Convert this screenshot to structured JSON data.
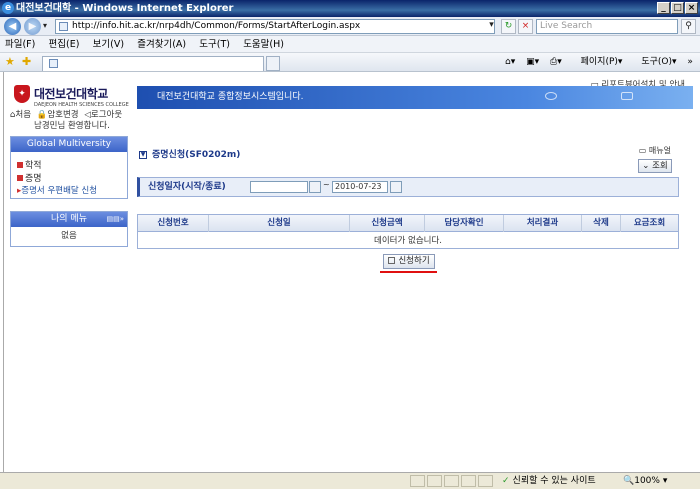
{
  "window": {
    "title": "대전보건대학 - Windows Internet Explorer"
  },
  "address": {
    "url": "http://info.hit.ac.kr/nrp4dh/Common/Forms/StartAfterLogin.aspx",
    "search_placeholder": "Live Search"
  },
  "menubar": [
    "파일(F)",
    "편집(E)",
    "보기(V)",
    "즐겨찾기(A)",
    "도구(T)",
    "도움말(H)"
  ],
  "commandbar": {
    "page": "페이지(P)",
    "tools": "도구(O)"
  },
  "site": {
    "top_info": "리포트뷰어설치 및 안내",
    "logo_name": "대전보건대학교",
    "logo_eng": "DAEJEON HEALTH SCIENCES COLLEGE",
    "banner": "대전보건대학교 종합정보시스템입니다.",
    "links": {
      "home": "처음",
      "password": "암호변경",
      "logout": "로그아웃"
    },
    "welcome": "남경민님 환영합니다."
  },
  "sidebar": {
    "header": "Global Multiversity",
    "items": [
      {
        "label": "학적"
      },
      {
        "label": "증명"
      },
      {
        "label": "증명서 우편배달 신청"
      }
    ],
    "my_menu": {
      "header": "나의 메뉴",
      "more": "▤▤»",
      "body": "없음"
    }
  },
  "page": {
    "title": "증명신청(SF0202m)",
    "manual": "매뉴얼",
    "inquiry": "조회",
    "filter_label": "신청일자(시작/종료)",
    "date_start": "",
    "date_end": "2010-07-23",
    "columns": [
      "신청번호",
      "신청일",
      "신청금액",
      "담당자확인",
      "처리결과",
      "삭제",
      "요금조회"
    ],
    "empty_text": "데이터가 없습니다.",
    "apply": "신청하기"
  },
  "status": {
    "zone": "신뢰할 수 있는 사이트",
    "zoom": "100%"
  }
}
